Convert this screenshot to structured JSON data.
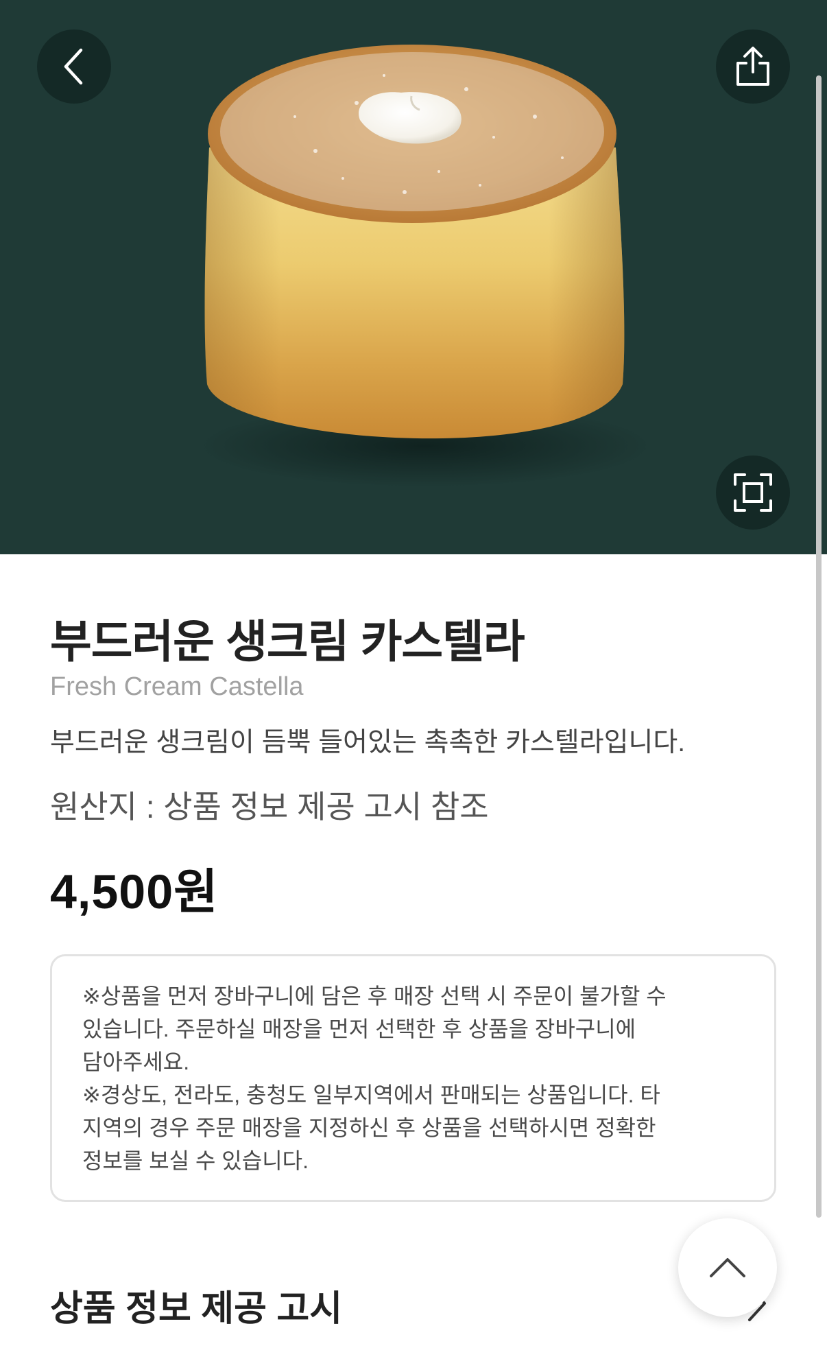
{
  "product": {
    "name_ko": "부드러운 생크림 카스텔라",
    "name_en": "Fresh Cream Castella",
    "description": "부드러운 생크림이 듬뿍 들어있는 촉촉한 카스텔라입니다.",
    "origin": "원산지 : 상품 정보 제공 고시 참조",
    "price": "4,500원"
  },
  "notice": {
    "lines": [
      "※상품을 먼저 장바구니에 담은 후 매장 선택 시 주문이 불가할 수",
      "있습니다. 주문하실 매장을 먼저 선택한 후 상품을 장바구니에",
      "담아주세요.",
      "※경상도, 전라도, 충청도 일부지역에서 판매되는 상품입니다. 타",
      "지역의 경우 주문 매장을 지정하신 후 상품을 선택하시면 정확한",
      "정보를 보실 수 있습니다."
    ]
  },
  "sections": {
    "product_info_notice": "상품 정보 제공 고시"
  },
  "icons": {
    "back": "chevron-left-icon",
    "share": "share-icon",
    "zoom": "fullscreen-icon",
    "scroll_top": "chevron-up-icon",
    "section_arrow": "chevron-right-icon"
  },
  "colors": {
    "hero_background": "#1f3a36",
    "button_background": "#142825",
    "title": "#222222",
    "subtitle": "#a1a1a1",
    "notice_border": "#e2e2e2"
  }
}
